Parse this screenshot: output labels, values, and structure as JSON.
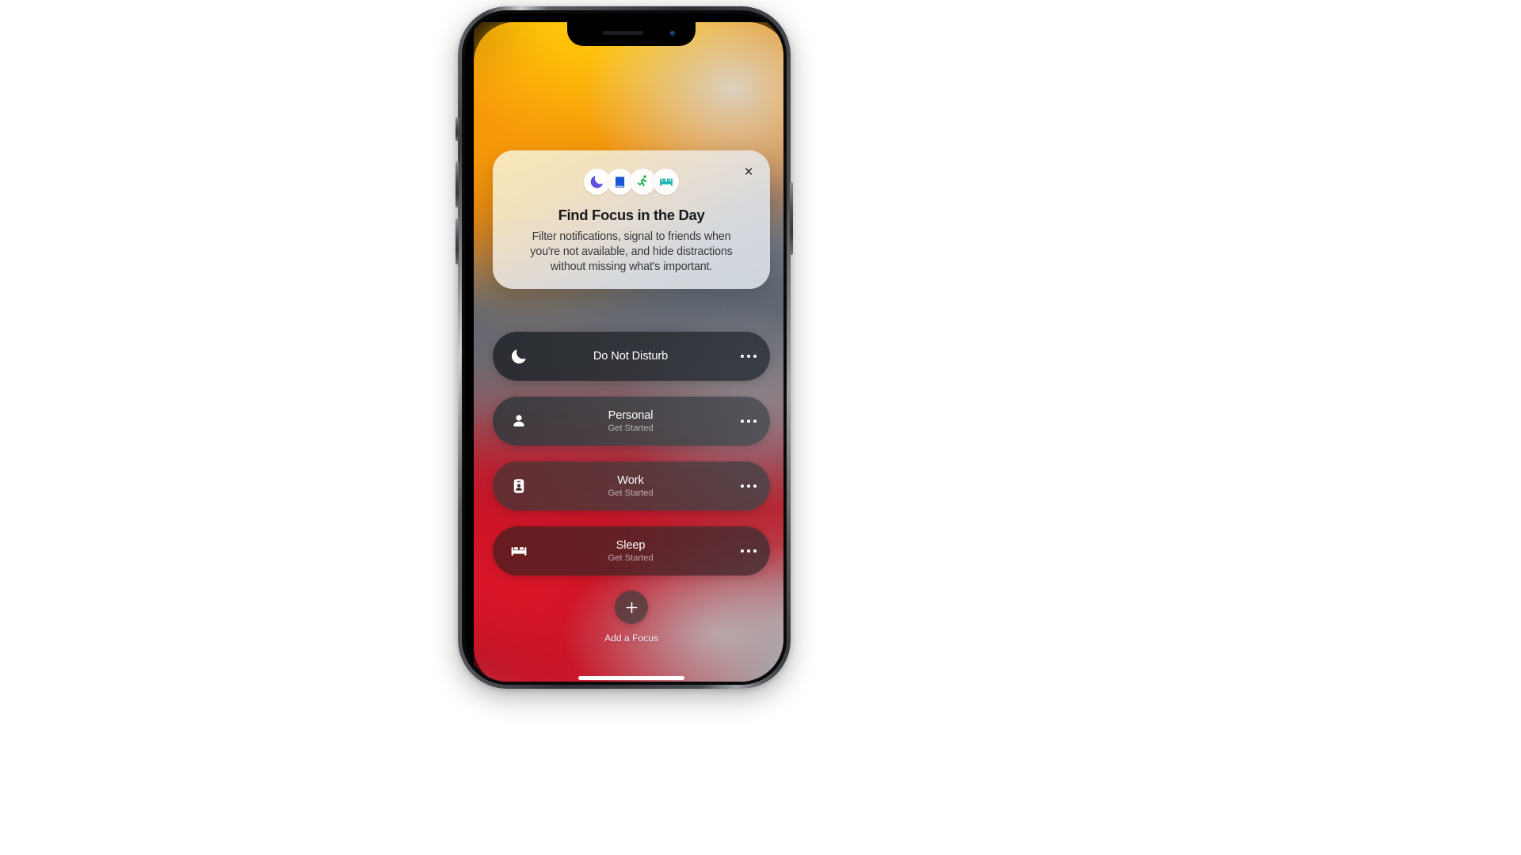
{
  "device": {
    "name": "iphone-12-pro-graphite",
    "notch": {
      "speaker_icon": "speaker-grille-icon",
      "camera_icon": "front-camera-icon"
    },
    "home_indicator": "home-indicator"
  },
  "wallpaper": {
    "description": "ios-blurred-gradient-wallpaper",
    "colors": {
      "top": "#ffc107",
      "upper_mid": "#e98b12",
      "mid": "#6d7885",
      "lower_mid": "#a33341",
      "bottom": "#c71325",
      "haze": "#d7dade"
    }
  },
  "card": {
    "close_label": "×",
    "icons": [
      {
        "name": "crescent-moon-icon",
        "color": "#5c50dd"
      },
      {
        "name": "book-icon",
        "color": "#1a56d6"
      },
      {
        "name": "running-person-icon",
        "color": "#1bb24a"
      },
      {
        "name": "bed-icon",
        "color": "#1fb5b0"
      }
    ],
    "title": "Find Focus in the Day",
    "body": "Filter notifications, signal to friends when you're not available, and hide distractions without missing what's important."
  },
  "focus_rows": [
    {
      "id": "do-not-disturb",
      "icon": "crescent-moon-icon",
      "title": "Do Not Disturb",
      "subtitle": "",
      "more_label": "•••"
    },
    {
      "id": "personal",
      "icon": "person-icon",
      "title": "Personal",
      "subtitle": "Get Started",
      "more_label": "•••"
    },
    {
      "id": "work",
      "icon": "id-badge-icon",
      "title": "Work",
      "subtitle": "Get Started",
      "more_label": "•••"
    },
    {
      "id": "sleep",
      "icon": "bed-icon",
      "title": "Sleep",
      "subtitle": "Get Started",
      "more_label": "•••"
    }
  ],
  "add_focus": {
    "icon": "plus-icon",
    "label": "Add a Focus"
  }
}
